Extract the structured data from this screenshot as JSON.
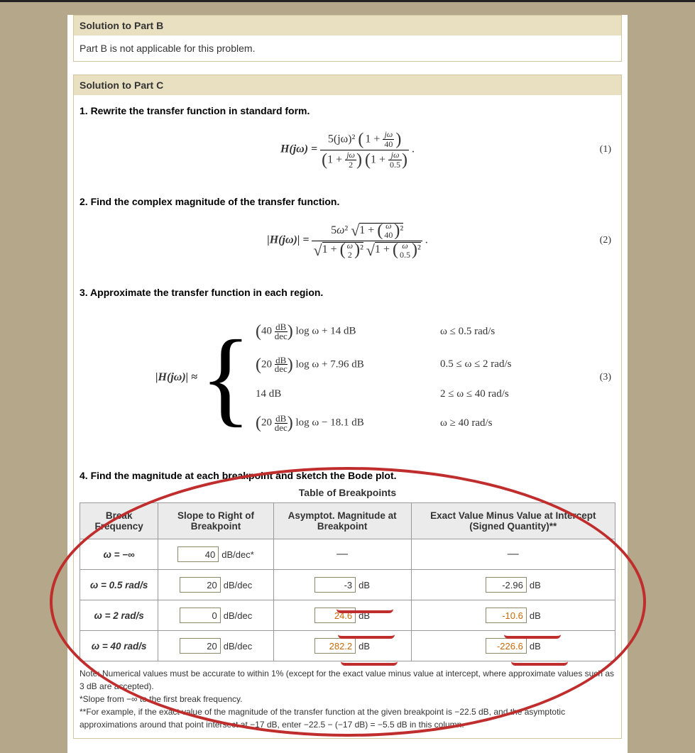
{
  "headers": {
    "partB": "Solution to Part B",
    "partC": "Solution to Part C"
  },
  "partB_body": "Part B is not applicable for this problem.",
  "steps": {
    "s1": "1. Rewrite the transfer function in standard form.",
    "s2": "2. Find the complex magnitude of the transfer function.",
    "s3": "3. Approximate the transfer function in each region.",
    "s4": "4. Find the magnitude at each breakpoint and sketch the Bode plot."
  },
  "eq": {
    "label": "H(jω) = ",
    "mag_label": "|H(jω)| = ",
    "approx_label": "|H(jω)| ≈ ",
    "num1": "(1)",
    "num2": "(2)",
    "num3": "(3)",
    "e1_num_left": "5(jω)²",
    "e1_num_right": "1 + jω/40",
    "e1_den_left": "1 + jω/2",
    "e1_den_right": "1 + jω/0.5",
    "e2_num_left": "5ω²",
    "e2_num_sqrt": "1 + (ω/40)²",
    "e2_den_left": "1 + (ω/2)²",
    "e2_den_right": "1 + (ω/0.5)²",
    "piece": [
      {
        "expr_pre": "40",
        "expr_post": "log ω + 14 dB",
        "cond": "ω ≤ 0.5 rad/s"
      },
      {
        "expr_pre": "20",
        "expr_post": "log ω + 7.96 dB",
        "cond": "0.5 ≤ ω ≤ 2 rad/s"
      },
      {
        "expr_pre": "14 dB",
        "expr_post": "",
        "cond": "2 ≤ ω ≤ 40 rad/s",
        "plain": true
      },
      {
        "expr_pre": "20",
        "expr_post": "log ω − 18.1 dB",
        "cond": "ω ≥ 40 rad/s"
      }
    ]
  },
  "table": {
    "caption": "Table of Breakpoints",
    "cols": [
      "Break Frequency",
      "Slope to Right of Breakpoint",
      "Asymptot. Magnitude at Breakpoint",
      "Exact Value Minus Value at Intercept (Signed Quantity)**"
    ],
    "rows": [
      {
        "freq": "ω = −∞",
        "slope": "40",
        "slope_unit": "dB/dec*",
        "asym": "—",
        "diff": "—"
      },
      {
        "freq": "ω = 0.5 rad/s",
        "slope": "20",
        "slope_unit": "dB/dec",
        "asym": "-3",
        "asym_unit": "dB",
        "diff": "-2.96",
        "diff_unit": "dB"
      },
      {
        "freq": "ω = 2 rad/s",
        "slope": "0",
        "slope_unit": "dB/dec",
        "asym": "24.6",
        "asym_unit": "dB",
        "asym_hl": true,
        "diff": "-10.6",
        "diff_unit": "dB",
        "diff_hl": true
      },
      {
        "freq": "ω = 40 rad/s",
        "slope": "20",
        "slope_unit": "dB/dec",
        "asym": "282.2",
        "asym_unit": "dB",
        "asym_hl": true,
        "diff": "-226.6",
        "diff_unit": "dB",
        "diff_hl": true
      }
    ]
  },
  "footnotes": {
    "f1": "Note: Numerical values must be accurate to within 1% (except for the exact value minus value at intercept, where approximate values such as 3 dB are accepted).",
    "f2": "*Slope from −∞ to the first break frequency.",
    "f3": "**For example, if the exact value of the magnitude of the transfer function at the given breakpoint is −22.5 dB, and the asymptotic approximations around that point intersect at −17 dB, enter −22.5 − (−17 dB) = −5.5 dB in this column."
  }
}
